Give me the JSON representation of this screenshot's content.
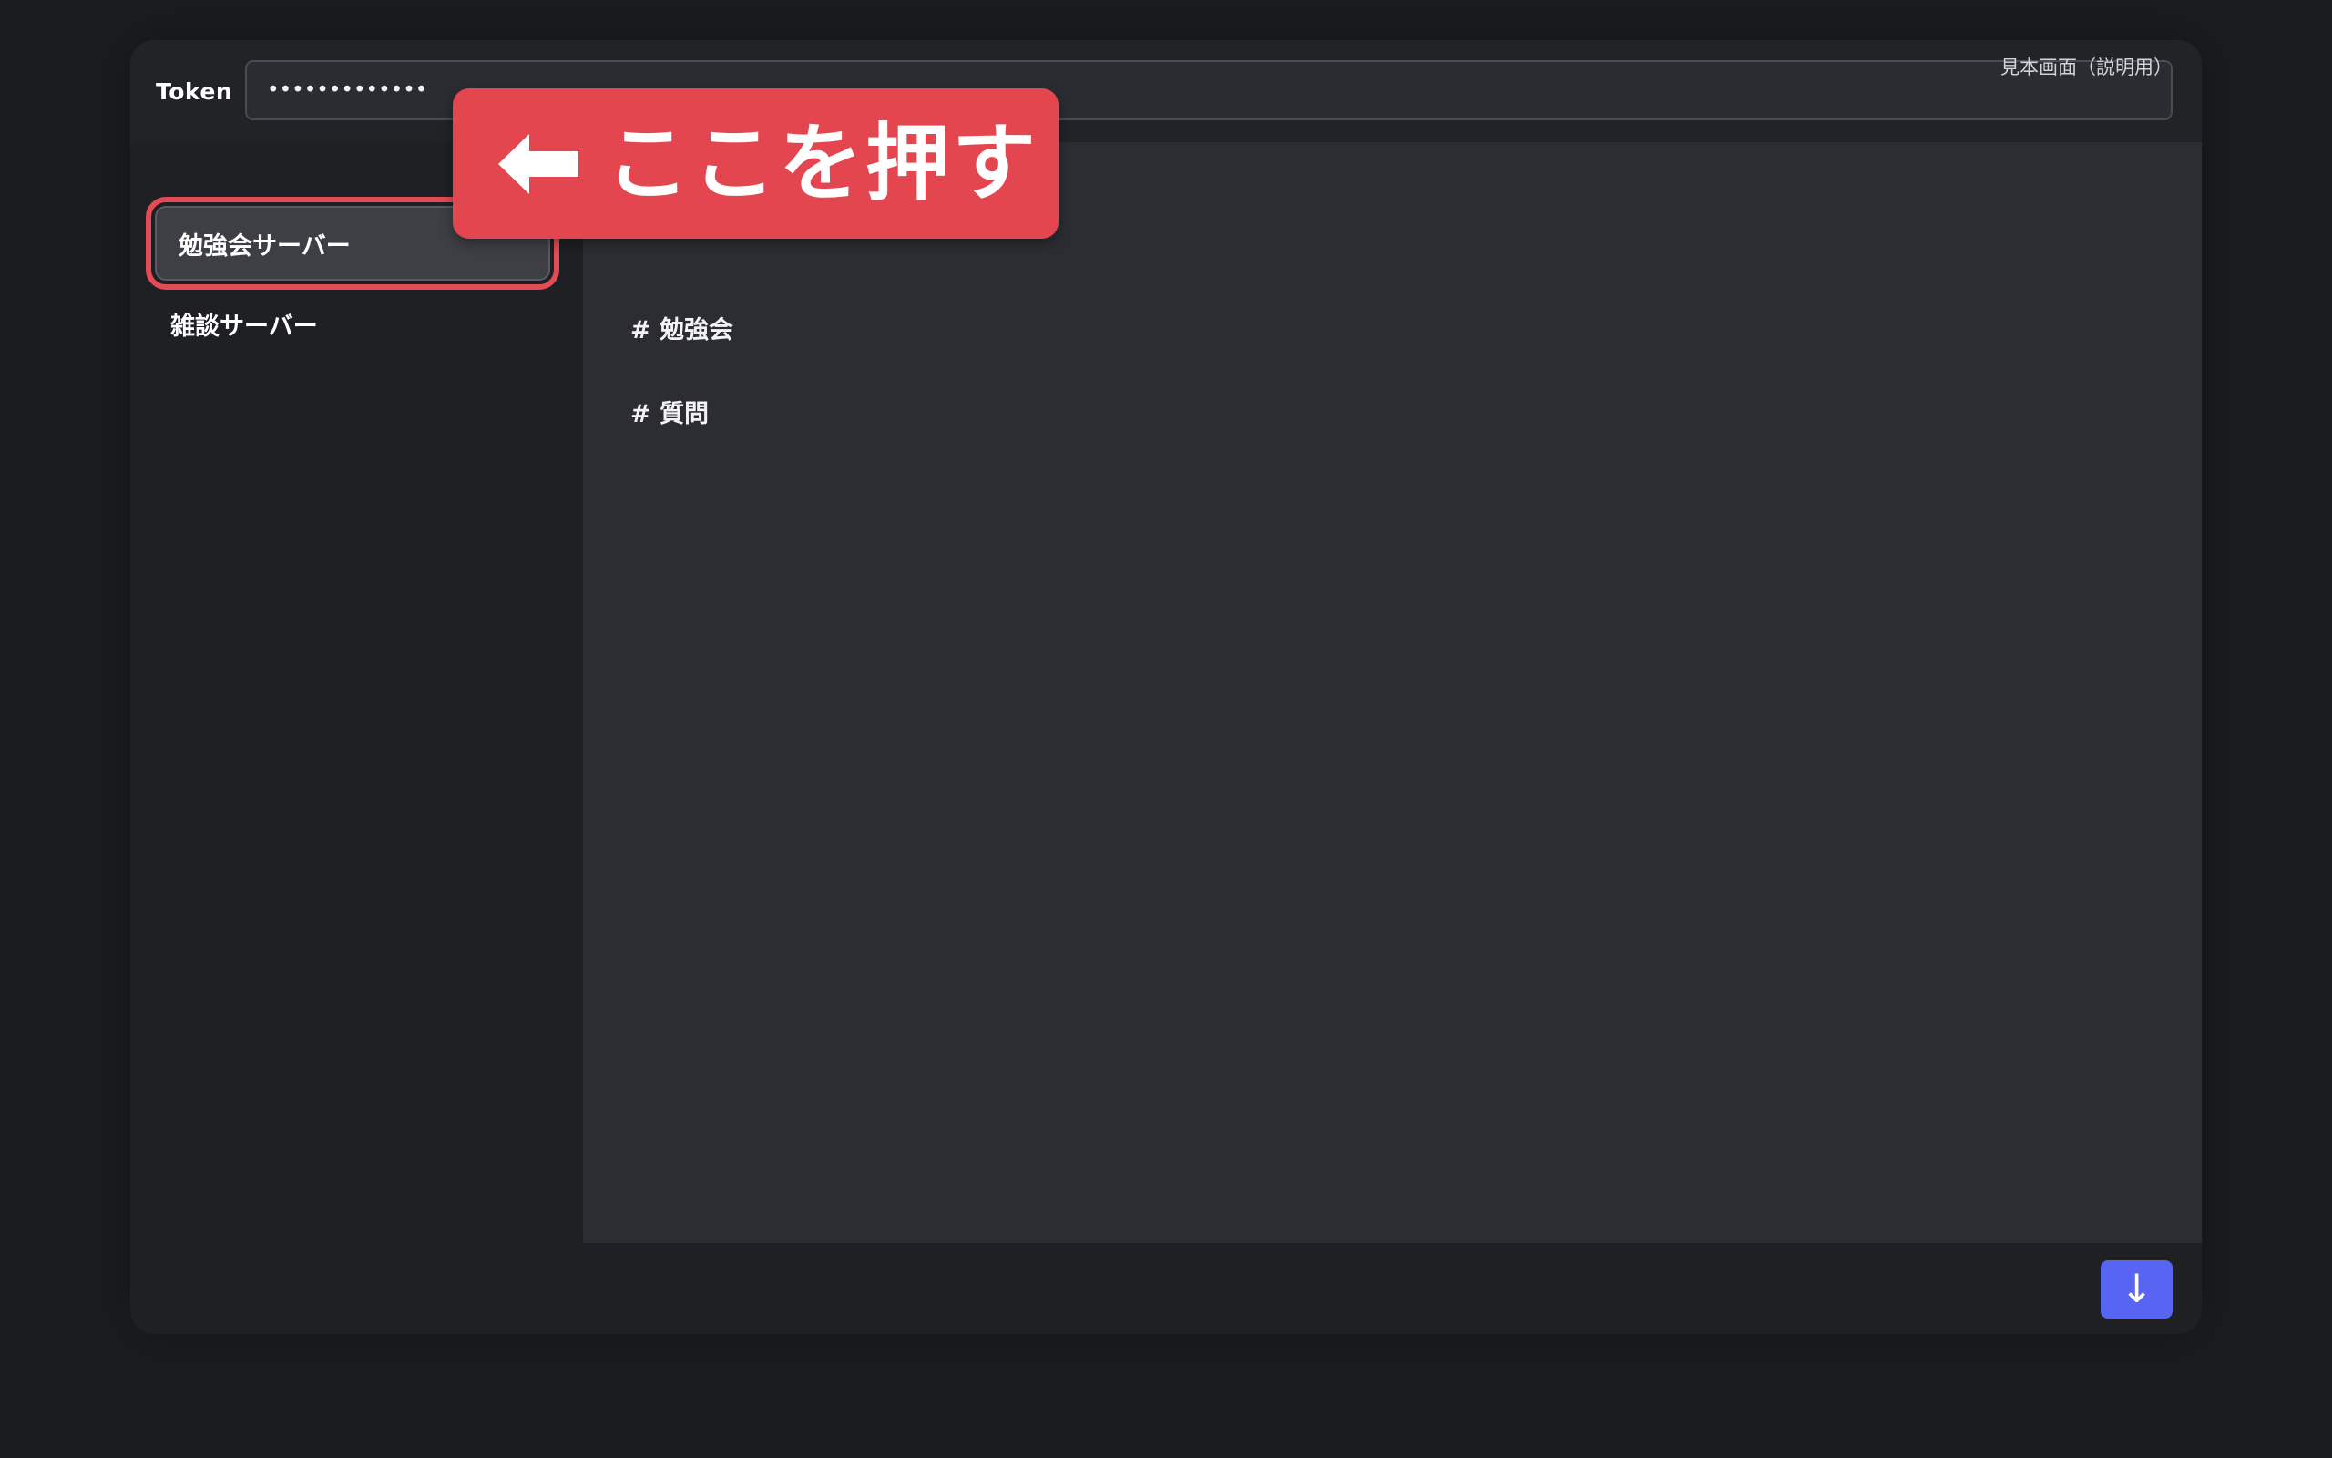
{
  "header": {
    "token_label": "Token",
    "token_value": "•••••••••••••",
    "sample_note": "見本画面（説明用）"
  },
  "sidebar": {
    "servers": [
      {
        "label": "勉強会サーバー",
        "selected": true
      },
      {
        "label": "雑談サーバー",
        "selected": false
      }
    ]
  },
  "main": {
    "channels": [
      {
        "label": "# 勉強会"
      },
      {
        "label": "# 質問"
      }
    ]
  },
  "callout": {
    "text": "ここを押す",
    "icon": "left-arrow-icon",
    "color": "#e3464f"
  },
  "actions": {
    "download_label": "↓",
    "download_icon": "down-arrow-icon",
    "button_color": "#5865f2"
  }
}
